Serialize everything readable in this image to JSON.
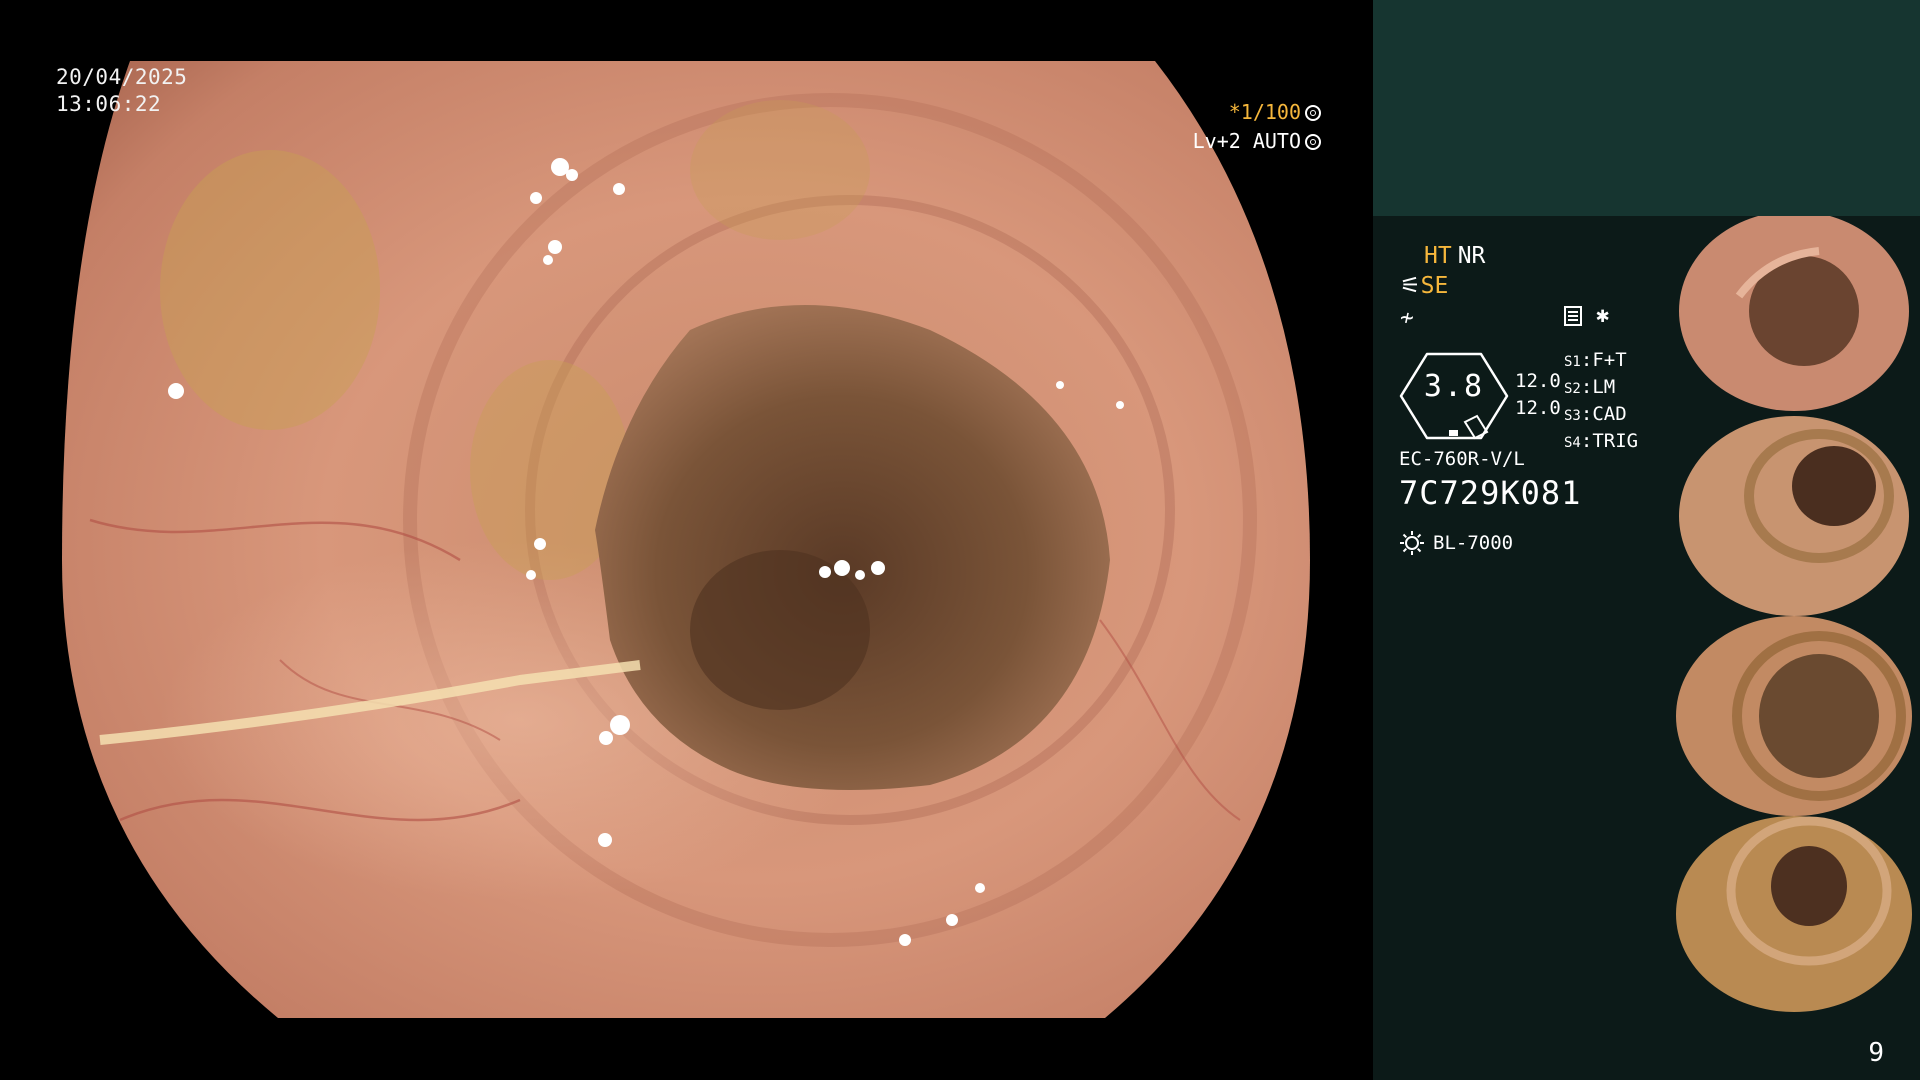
{
  "overlay": {
    "date": "20/04/2025",
    "time": "13:06:22",
    "shutter": "*1/100",
    "level_auto": "Lv+2 AUTO"
  },
  "panel": {
    "ht": "HT",
    "nr": "NR",
    "se": "SE",
    "filter_symbol": "≁",
    "gauge_value": "3.8",
    "values": [
      "12.0",
      "12.0"
    ],
    "switches": [
      {
        "key": "S1",
        "value": "F+T"
      },
      {
        "key": "S2",
        "value": "LM"
      },
      {
        "key": "S3",
        "value": "CAD"
      },
      {
        "key": "S4",
        "value": "TRIG"
      }
    ],
    "scope_model": "EC-760R-V/L",
    "serial": "7C729K081",
    "light_source": "BL-7000",
    "page_number": "9"
  },
  "colors": {
    "amber": "#f6b73c",
    "panel_top": "#163530",
    "panel_bg": "#0c1a18"
  }
}
